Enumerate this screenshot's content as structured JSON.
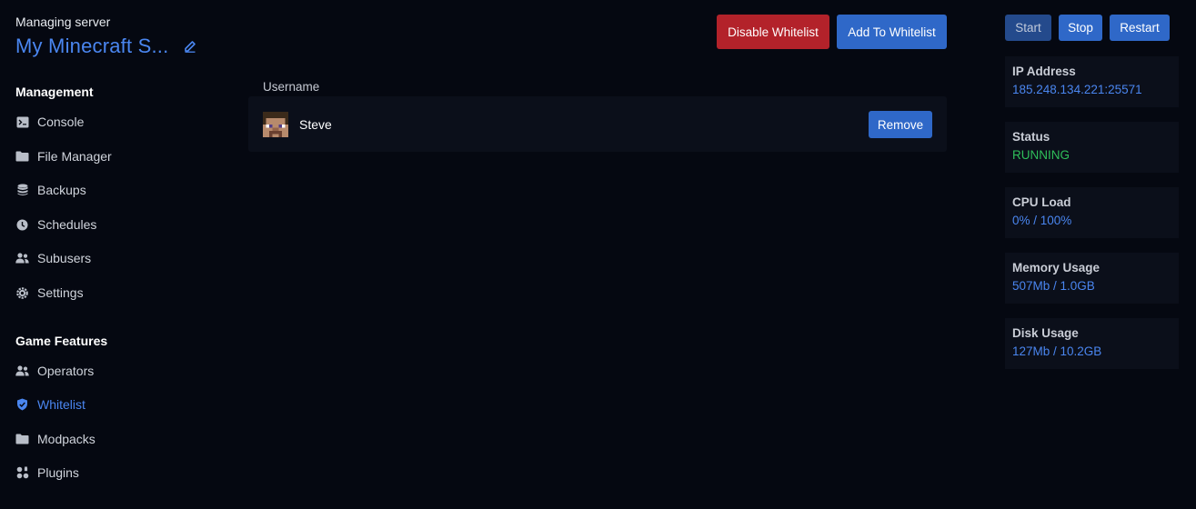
{
  "server": {
    "subtitle": "Managing server",
    "name": "My Minecraft S...",
    "edit_icon": "edit-icon"
  },
  "sidebar": {
    "sections": [
      {
        "title": "Management",
        "items": [
          {
            "label": "Console",
            "icon": "console-icon"
          },
          {
            "label": "File Manager",
            "icon": "folder-icon"
          },
          {
            "label": "Backups",
            "icon": "database-icon"
          },
          {
            "label": "Schedules",
            "icon": "clock-icon"
          },
          {
            "label": "Subusers",
            "icon": "users-icon"
          },
          {
            "label": "Settings",
            "icon": "gear-icon"
          }
        ]
      },
      {
        "title": "Game Features",
        "items": [
          {
            "label": "Operators",
            "icon": "users-icon"
          },
          {
            "label": "Whitelist",
            "icon": "shield-icon",
            "active": true
          },
          {
            "label": "Modpacks",
            "icon": "folder-icon"
          },
          {
            "label": "Plugins",
            "icon": "puzzle-icon"
          }
        ]
      }
    ]
  },
  "toolbar": {
    "disable_label": "Disable Whitelist",
    "add_label": "Add To Whitelist"
  },
  "whitelist": {
    "column_header": "Username",
    "rows": [
      {
        "username": "Steve",
        "remove_label": "Remove"
      }
    ]
  },
  "power": {
    "start_label": "Start",
    "stop_label": "Stop",
    "restart_label": "Restart"
  },
  "stats": [
    {
      "label": "IP Address",
      "value": "185.248.134.221:25571"
    },
    {
      "label": "Status",
      "value": "RUNNING"
    },
    {
      "label": "CPU Load",
      "value": "0% / 100%"
    },
    {
      "label": "Memory Usage",
      "value": "507Mb / 1.0GB"
    },
    {
      "label": "Disk Usage",
      "value": "127Mb / 10.2GB"
    }
  ],
  "colors": {
    "background": "#050811",
    "accent": "#4a86f0",
    "danger": "#b3222a",
    "primary_button": "#2f68c8",
    "status_running": "#2fbf5a"
  }
}
